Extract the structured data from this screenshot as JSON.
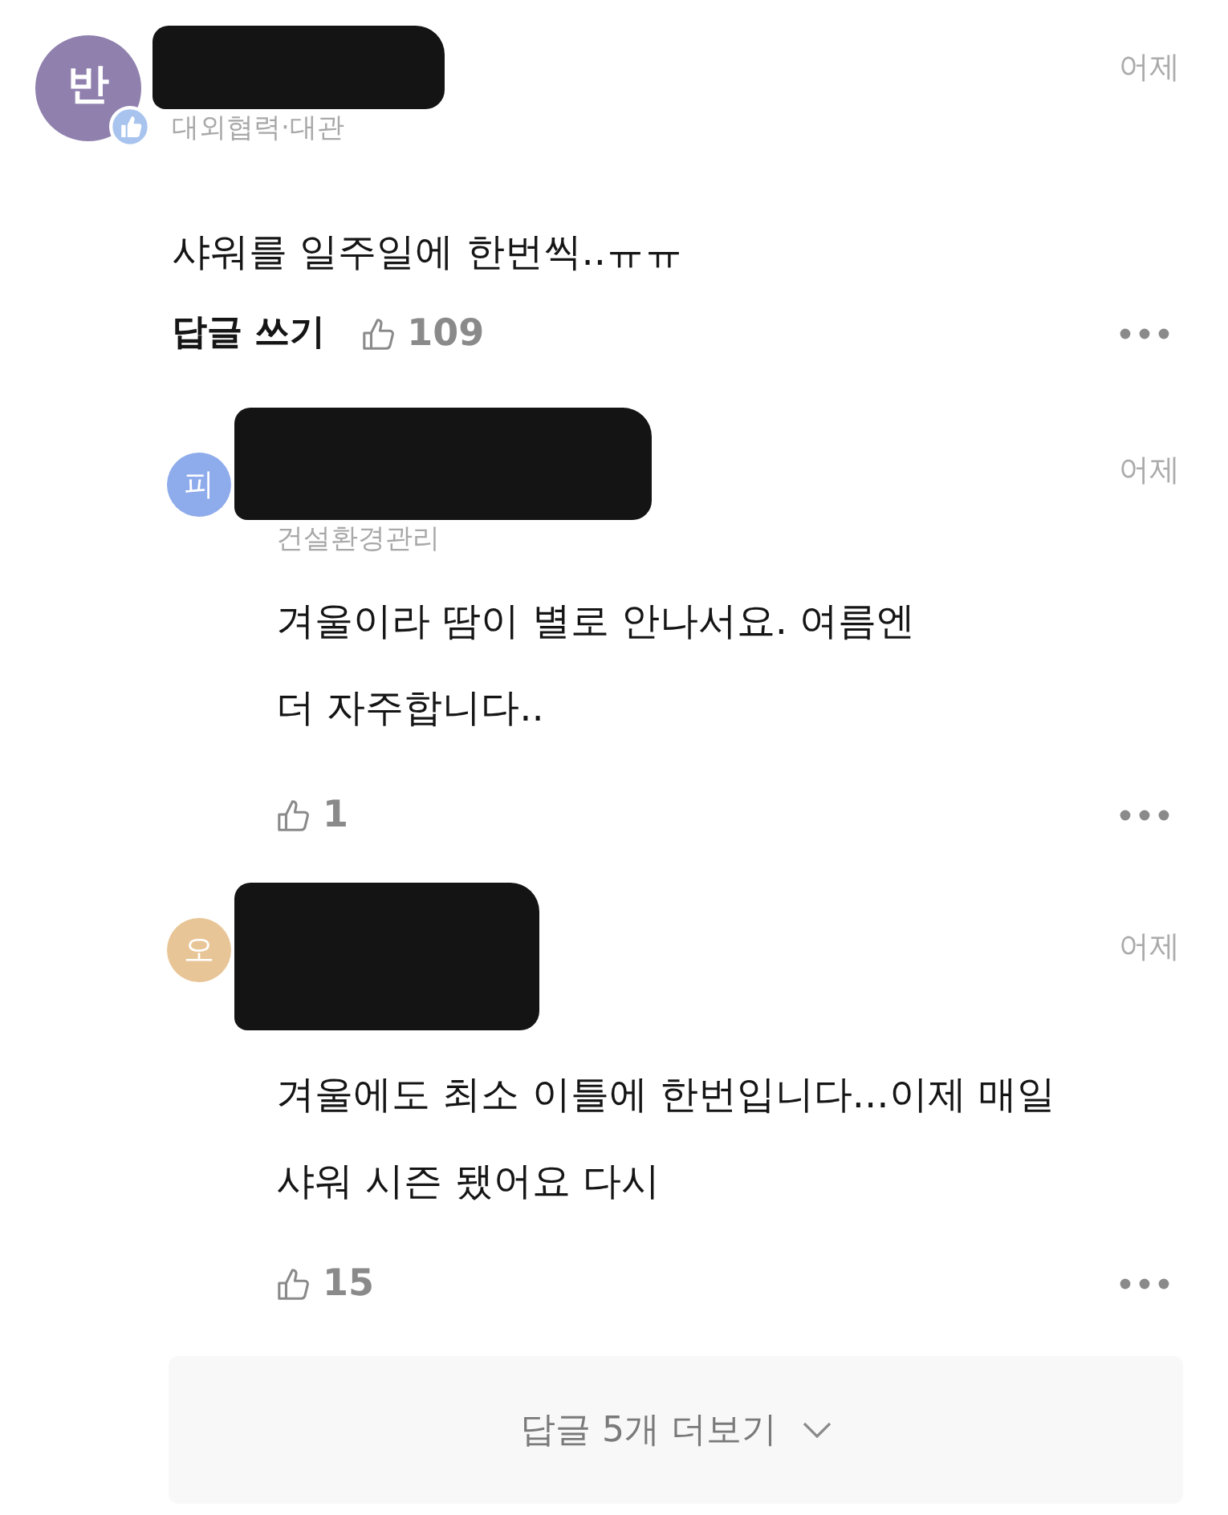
{
  "comments": [
    {
      "kind": "comment",
      "avatar_letter": "반",
      "color": "#8f80ad",
      "badge": true,
      "name_redacted": true,
      "subtitle": "대외협력·대관",
      "time": "어제",
      "text": "샤워를 일주일에 한번씩..ㅠㅠ",
      "reply_label": "답글 쓰기",
      "likes": "109"
    },
    {
      "kind": "reply",
      "avatar_letter": "피",
      "color": "#8eabeb",
      "badge": false,
      "name_redacted": true,
      "subtitle": "건설환경관리",
      "time": "어제",
      "text": "겨울이라 땀이 별로 안나서요. 여름엔\n더 자주합니다..",
      "likes": "1"
    },
    {
      "kind": "reply",
      "avatar_letter": "오",
      "color": "#e8c596",
      "badge": false,
      "name_redacted": true,
      "time": "어제",
      "text": "겨울에도 최소 이틀에 한번입니다...이제 매일\n샤워 시즌 됐어요 다시",
      "likes": "15"
    }
  ],
  "more_replies": {
    "label": "답글 5개 더보기"
  }
}
